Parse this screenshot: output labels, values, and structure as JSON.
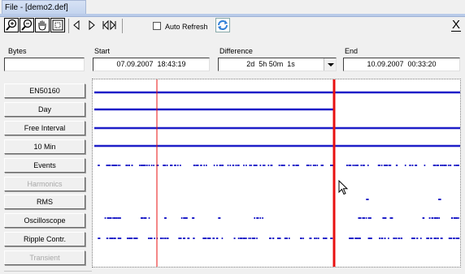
{
  "window": {
    "title": "File - [demo2.def]"
  },
  "toolbar": {
    "auto_refresh_label": "Auto Refresh",
    "auto_refresh_checked": false,
    "close_glyph": "X"
  },
  "header": {
    "bytes": {
      "label": "Bytes",
      "value": ""
    },
    "start": {
      "label": "Start",
      "value": "07.09.2007  18:43:19"
    },
    "difference": {
      "label": "Difference",
      "value": "2d  5h 50m  1s"
    },
    "end": {
      "label": "End",
      "value": "10.09.2007  00:33:20"
    }
  },
  "channels": [
    {
      "label": "EN50160",
      "enabled": true
    },
    {
      "label": "Day",
      "enabled": true
    },
    {
      "label": "Free Interval",
      "enabled": true
    },
    {
      "label": "10 Min",
      "enabled": true
    },
    {
      "label": "Events",
      "enabled": true
    },
    {
      "label": "Harmonics",
      "enabled": false
    },
    {
      "label": "RMS",
      "enabled": true
    },
    {
      "label": "Oscilloscope",
      "enabled": true
    },
    {
      "label": "Ripple Contr.",
      "enabled": true
    },
    {
      "label": "Transient",
      "enabled": false
    }
  ],
  "colors": {
    "data": "#1e1ec8",
    "cursor": "#e81010",
    "title_bar": "#b9cbe9",
    "refresh_icon": "#2f7fd8"
  },
  "icons": [
    "zoom-in-icon",
    "zoom-out-icon",
    "pan-hand-icon",
    "fit-to-window-icon",
    "previous-icon",
    "next-icon",
    "first-last-icon",
    "refresh-icon",
    "mouse-pointer-icon"
  ]
}
